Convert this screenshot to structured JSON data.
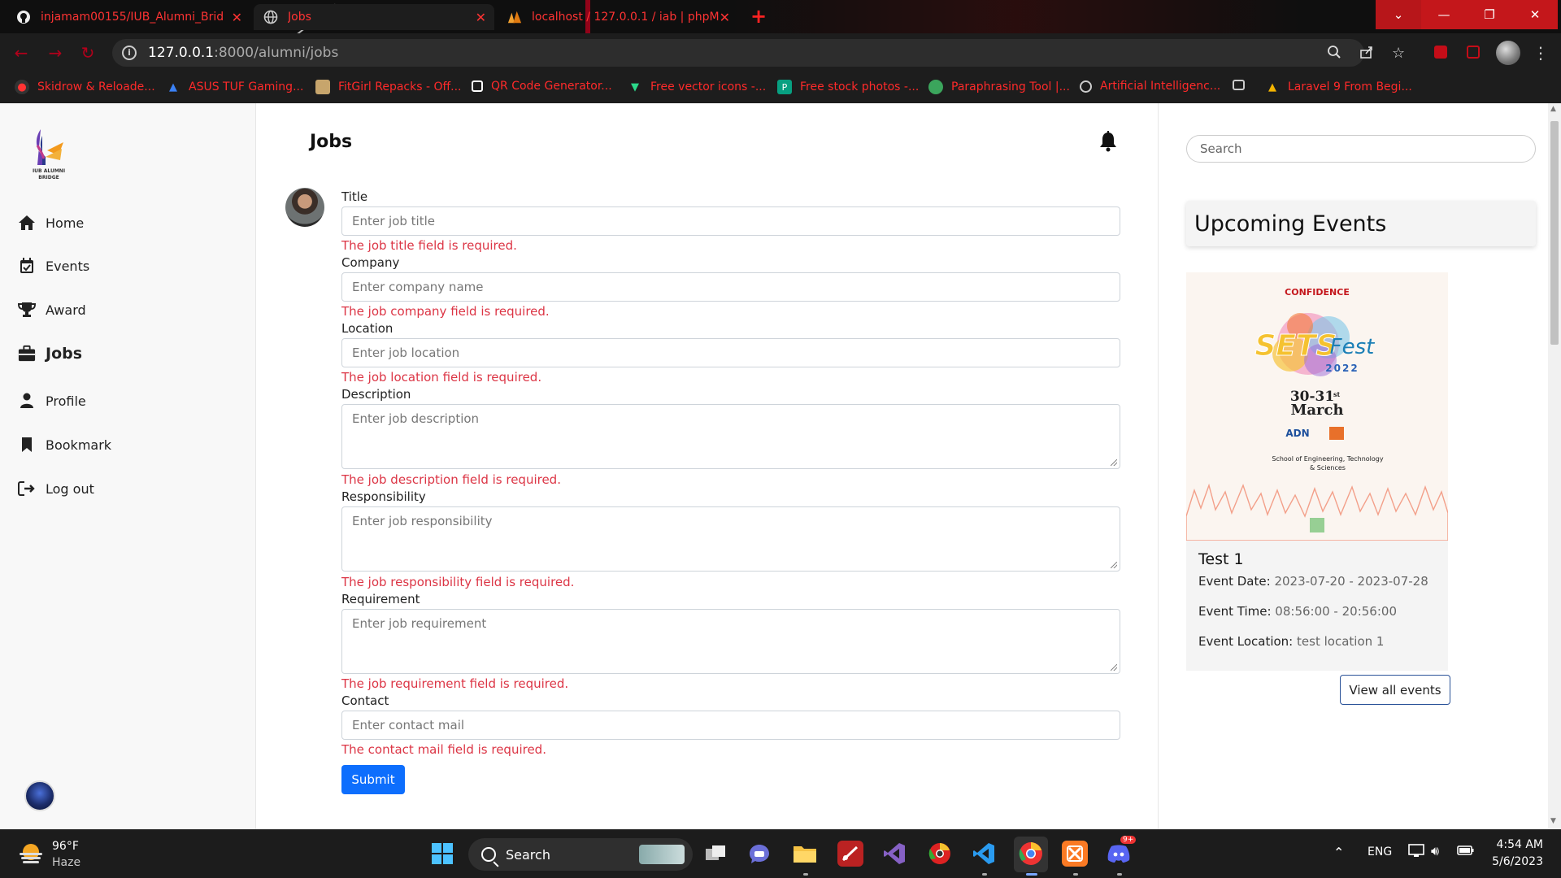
{
  "browser": {
    "tabs": [
      {
        "title": "injamam00155/IUB_Alumni_Brid",
        "icon": "github-icon"
      },
      {
        "title": "Jobs",
        "icon": "globe-icon"
      },
      {
        "title": "localhost / 127.0.0.1 / iab | phpM",
        "icon": "phpmyadmin-icon"
      }
    ],
    "url_host": "127.0.0.1",
    "url_path": ":8000/alumni/jobs",
    "bookmarks": [
      "Skidrow & Reloade...",
      "ASUS TUF Gaming...",
      "FitGirl Repacks - Off...",
      "QR Code Generator...",
      "Free vector icons -...",
      "Free stock photos -...",
      "Paraphrasing Tool |...",
      "Artificial Intelligenc...",
      "Laravel 9 From Begi..."
    ]
  },
  "sidebar": {
    "logo_text": "IUB ALUMNI BRIDGE",
    "items": [
      {
        "label": "Home",
        "icon": "home-icon"
      },
      {
        "label": "Events",
        "icon": "calendar-check-icon"
      },
      {
        "label": "Award",
        "icon": "trophy-icon"
      },
      {
        "label": "Jobs",
        "icon": "briefcase-icon",
        "active": true
      },
      {
        "label": "Profile",
        "icon": "user-icon"
      },
      {
        "label": "Bookmark",
        "icon": "bookmark-icon"
      },
      {
        "label": "Log out",
        "icon": "logout-icon"
      }
    ]
  },
  "main": {
    "title": "Jobs",
    "form": {
      "fields": [
        {
          "label": "Title",
          "placeholder": "Enter job title",
          "error": "The job title field is required."
        },
        {
          "label": "Company",
          "placeholder": "Enter company name",
          "error": "The job company field is required."
        },
        {
          "label": "Location",
          "placeholder": "Enter job location",
          "error": "The job location field is required."
        },
        {
          "label": "Description",
          "placeholder": "Enter job description",
          "error": "The job description field is required."
        },
        {
          "label": "Responsibility",
          "placeholder": "Enter job responsibility",
          "error": "The job responsibility field is required."
        },
        {
          "label": "Requirement",
          "placeholder": "Enter job requirement",
          "error": "The job requirement field is required."
        },
        {
          "label": "Contact",
          "placeholder": "Enter contact mail",
          "error": "The contact mail field is required."
        }
      ],
      "submit_label": "Submit"
    }
  },
  "right": {
    "search_placeholder": "Search",
    "events_heading": "Upcoming Events",
    "poster": {
      "brand": "CONFIDENCE",
      "title": "SETS",
      "title2": "Fest",
      "year": "2022",
      "dates": "30-31",
      "dates_suffix": "st",
      "month": "March",
      "sponsor": "ADN",
      "school": "School of Engineering, Technology & Sciences"
    },
    "event": {
      "name": "Test 1",
      "date_label": "Event Date:",
      "date_value": "2023-07-20 - 2023-07-28",
      "time_label": "Event Time:",
      "time_value": "08:56:00 - 20:56:00",
      "location_label": "Event Location:",
      "location_value": "test location 1"
    },
    "view_all_label": "View all events"
  },
  "taskbar": {
    "weather_temp": "96°F",
    "weather_cond": "Haze",
    "search_label": "Search",
    "language": "ENG",
    "time": "4:54 AM",
    "date": "5/6/2023",
    "discord_badge": "9+"
  },
  "colors": {
    "primary": "#0d6efd",
    "error": "#dc3545",
    "chrome_accent": "#ff2a2a"
  }
}
